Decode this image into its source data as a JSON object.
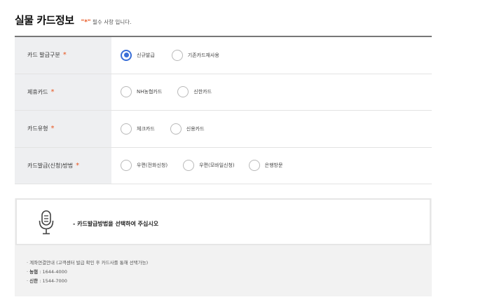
{
  "header": {
    "title": "실물 카드정보",
    "required_mark": "\"*\"",
    "required_text": "필수 사항 입니다."
  },
  "form": {
    "rows": [
      {
        "label": "카드 발급구분",
        "options": [
          {
            "label": "신규발급",
            "checked": true
          },
          {
            "label": "기존카드재사용",
            "checked": false
          }
        ]
      },
      {
        "label": "제휴카드",
        "options": [
          {
            "label": "NH농협카드",
            "checked": false
          },
          {
            "label": "신한카드",
            "checked": false
          }
        ]
      },
      {
        "label": "카드유형",
        "options": [
          {
            "label": "체크카드",
            "checked": false
          },
          {
            "label": "신용카드",
            "checked": false
          }
        ]
      },
      {
        "label": "카드발급(신청)방법",
        "options": [
          {
            "label": "우편(전화신청)",
            "checked": false
          },
          {
            "label": "우편(모바일신청)",
            "checked": false
          },
          {
            "label": "은행방문",
            "checked": false
          }
        ]
      }
    ],
    "required_star": "*"
  },
  "notice": {
    "icon": "microphone-icon",
    "message": "- 카드발급방법을 선택하여 주십시오",
    "notes": [
      {
        "prefix": "·",
        "bold": "",
        "text": "계좌연결안내 (고객센터 발급 확인 후 카드사를 통해 선택가능)"
      },
      {
        "prefix": "·",
        "bold": "농협",
        "text": " : 1644-4000"
      },
      {
        "prefix": "·",
        "bold": "신한",
        "text": " : 1544-7000"
      }
    ]
  },
  "colors": {
    "accent": "#3a6fd8",
    "required": "#e8541e"
  }
}
